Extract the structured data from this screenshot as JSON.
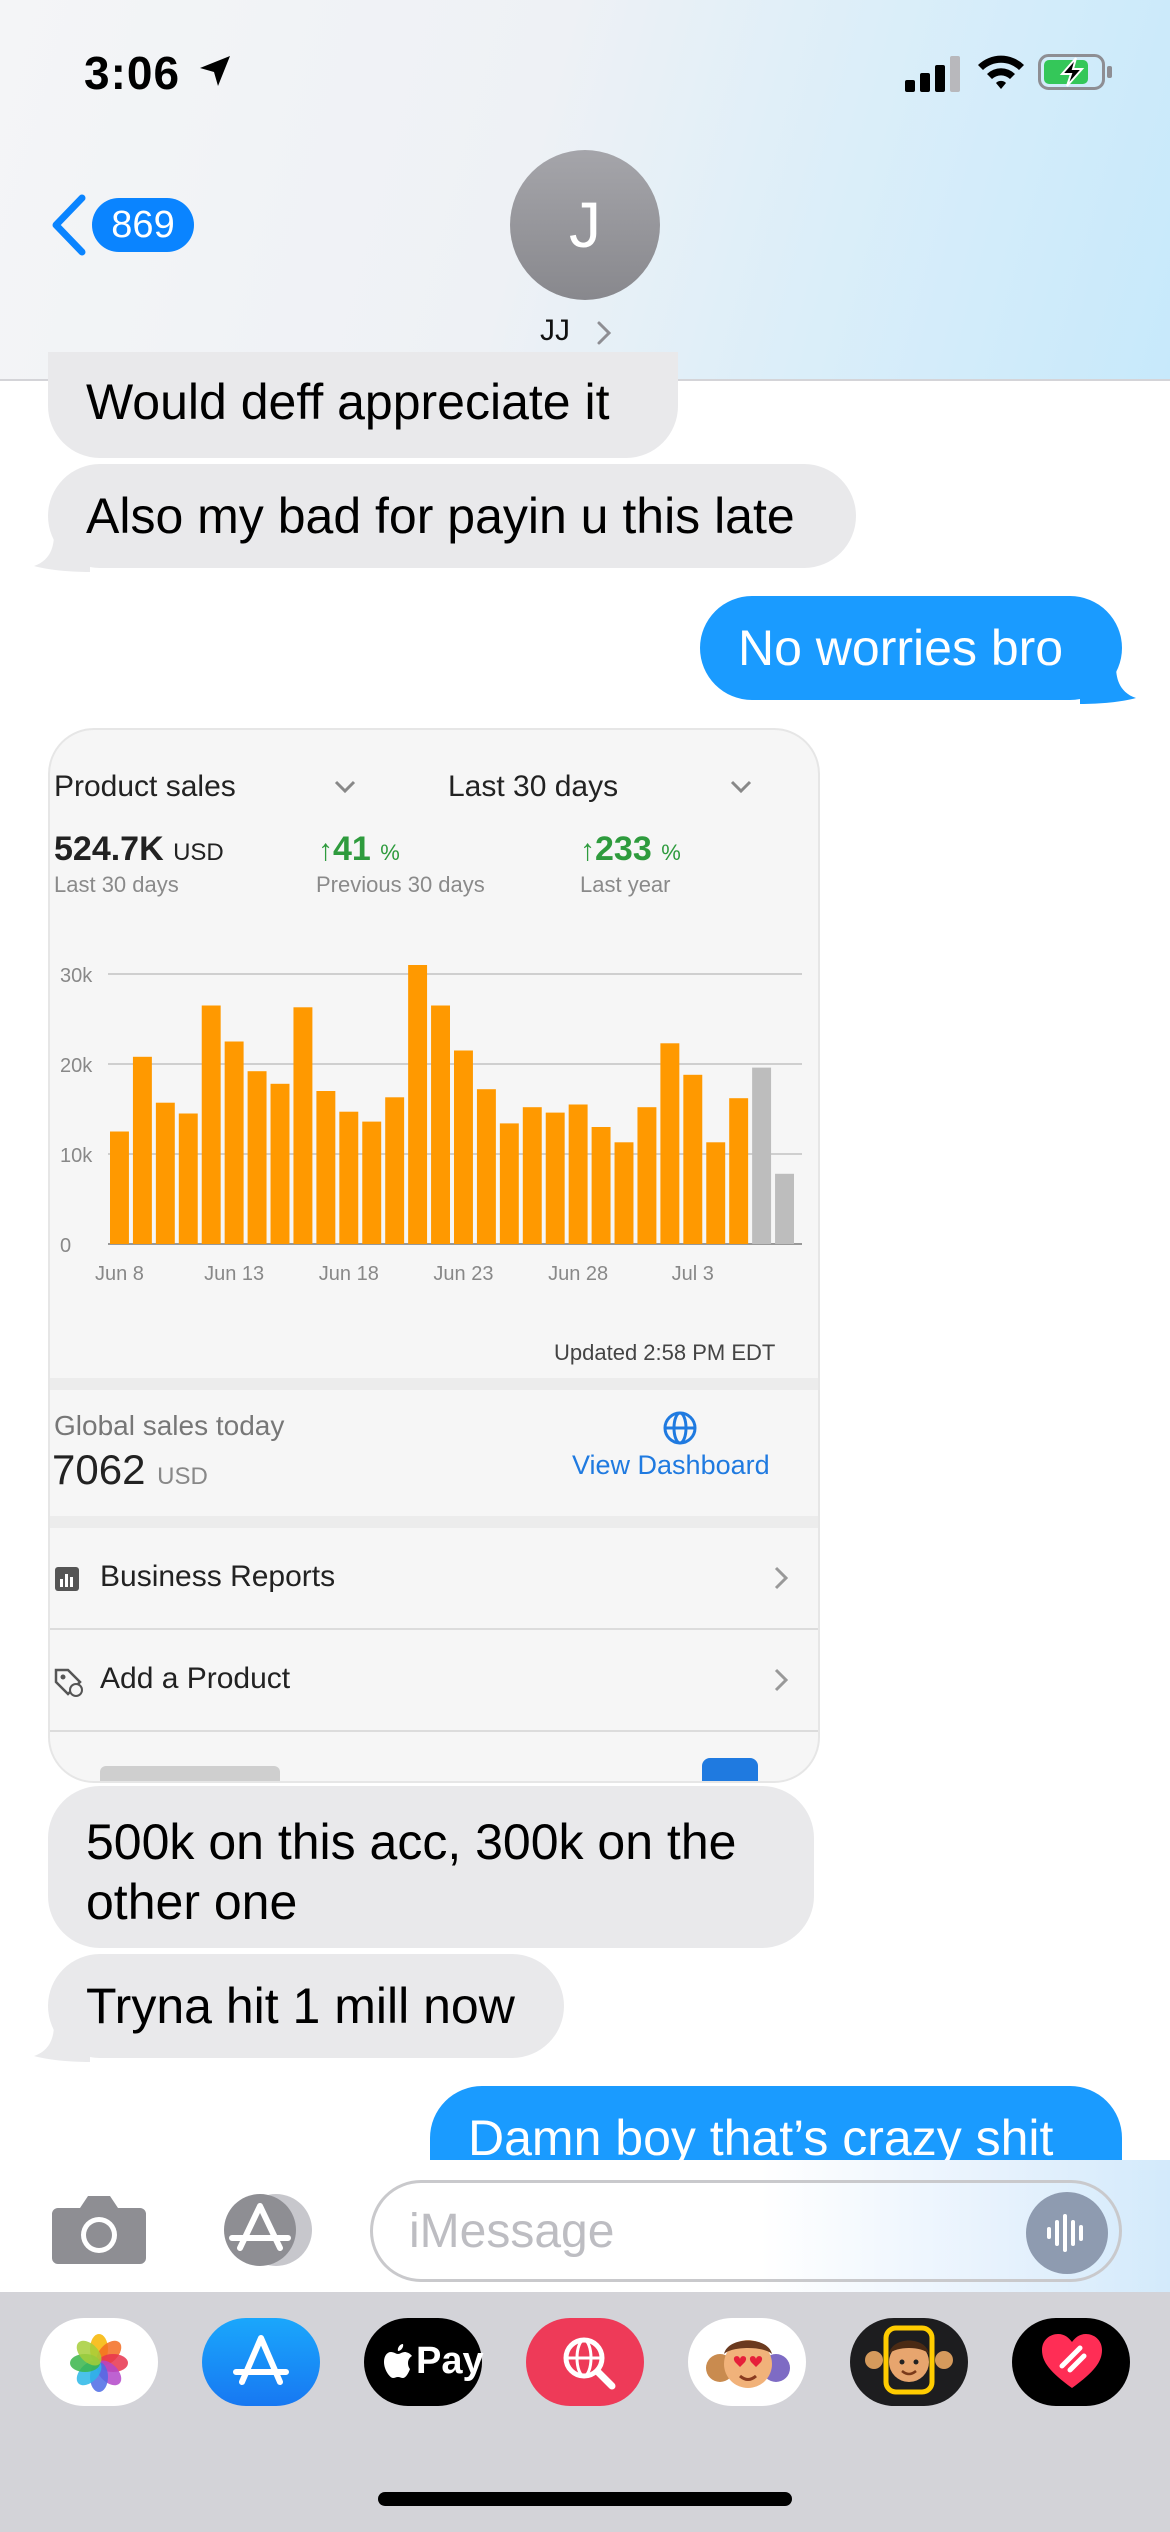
{
  "status": {
    "time": "3:06"
  },
  "header": {
    "back_count": "869",
    "avatar_initial": "J",
    "contact_name": "JJ"
  },
  "messages": {
    "m1": "Would deff appreciate it",
    "m2": "Also my bad for payin u this late",
    "m3": "No worries bro",
    "m4": "500k on this acc, 300k on the other one",
    "m5": "Tryna hit 1 mill now",
    "m6": "Damn boy that’s crazy shit"
  },
  "screenshot": {
    "dropdown_metric": "Product sales",
    "dropdown_range": "Last 30 days",
    "total_value": "524.7K",
    "total_unit": "USD",
    "total_label": "Last 30 days",
    "prev_value": "41",
    "prev_unit": "%",
    "prev_label": "Previous 30 days",
    "year_value": "233",
    "year_unit": "%",
    "year_label": "Last year",
    "updated": "Updated 2:58 PM EDT",
    "global_label": "Global sales today",
    "global_value": "7062",
    "global_unit": "USD",
    "view_dashboard": "View Dashboard",
    "row1": "Business Reports",
    "row2": "Add a Product"
  },
  "chart_data": {
    "type": "bar",
    "y_ticks": [
      "30k",
      "20k",
      "10k",
      "0"
    ],
    "x_ticks": [
      "Jun 8",
      "Jun 13",
      "Jun 18",
      "Jun 23",
      "Jun 28",
      "Jul 3"
    ],
    "ylim": [
      0,
      30000
    ],
    "values": [
      12500,
      20800,
      15700,
      14500,
      26500,
      22500,
      19200,
      17800,
      26300,
      17000,
      14700,
      13600,
      16300,
      31000,
      26500,
      21500,
      17200,
      13400,
      15200,
      14600,
      15500,
      13000,
      11300,
      15200,
      22300,
      18800,
      11300,
      16200,
      19600,
      7800
    ],
    "colors": {
      "bar": "#ff9900",
      "pending": "#bdbdbd"
    },
    "pending_count": 2,
    "grid": true
  },
  "input": {
    "placeholder": "iMessage"
  }
}
